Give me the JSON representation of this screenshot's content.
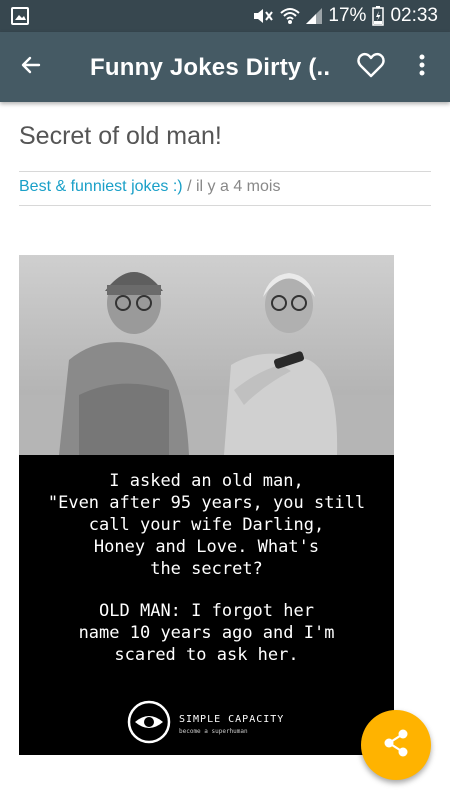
{
  "status_bar": {
    "battery": "17%",
    "time": "02:33",
    "icons": [
      "gallery-icon",
      "mute-icon",
      "wifi-icon",
      "signal-icon",
      "battery-charging-icon"
    ]
  },
  "app_bar": {
    "title": "Funny Jokes Dirty (...",
    "icons": [
      "back-arrow-icon",
      "heart-outline-icon",
      "more-vert-icon"
    ]
  },
  "post": {
    "title": "Secret of old man!",
    "category": "Best & funniest jokes :)",
    "separator": " / ",
    "time_ago": "il y a 4 mois"
  },
  "joke_image": {
    "lines_1": [
      "I asked an old man,",
      "\"Even after 95 years, you still",
      "call your wife Darling,",
      "Honey and Love. What's",
      "the secret?"
    ],
    "lines_2": [
      "OLD MAN: I forgot her",
      "name 10 years ago and I'm",
      "scared to ask her."
    ],
    "brand_name": "SIMPLE CAPACITY",
    "brand_tagline": "become a superhuman"
  },
  "fab": {
    "icon": "share-icon"
  },
  "colors": {
    "status_bar": "#37474f",
    "app_bar": "#455a64",
    "accent": "#1aa0c8",
    "fab": "#ffb300"
  }
}
